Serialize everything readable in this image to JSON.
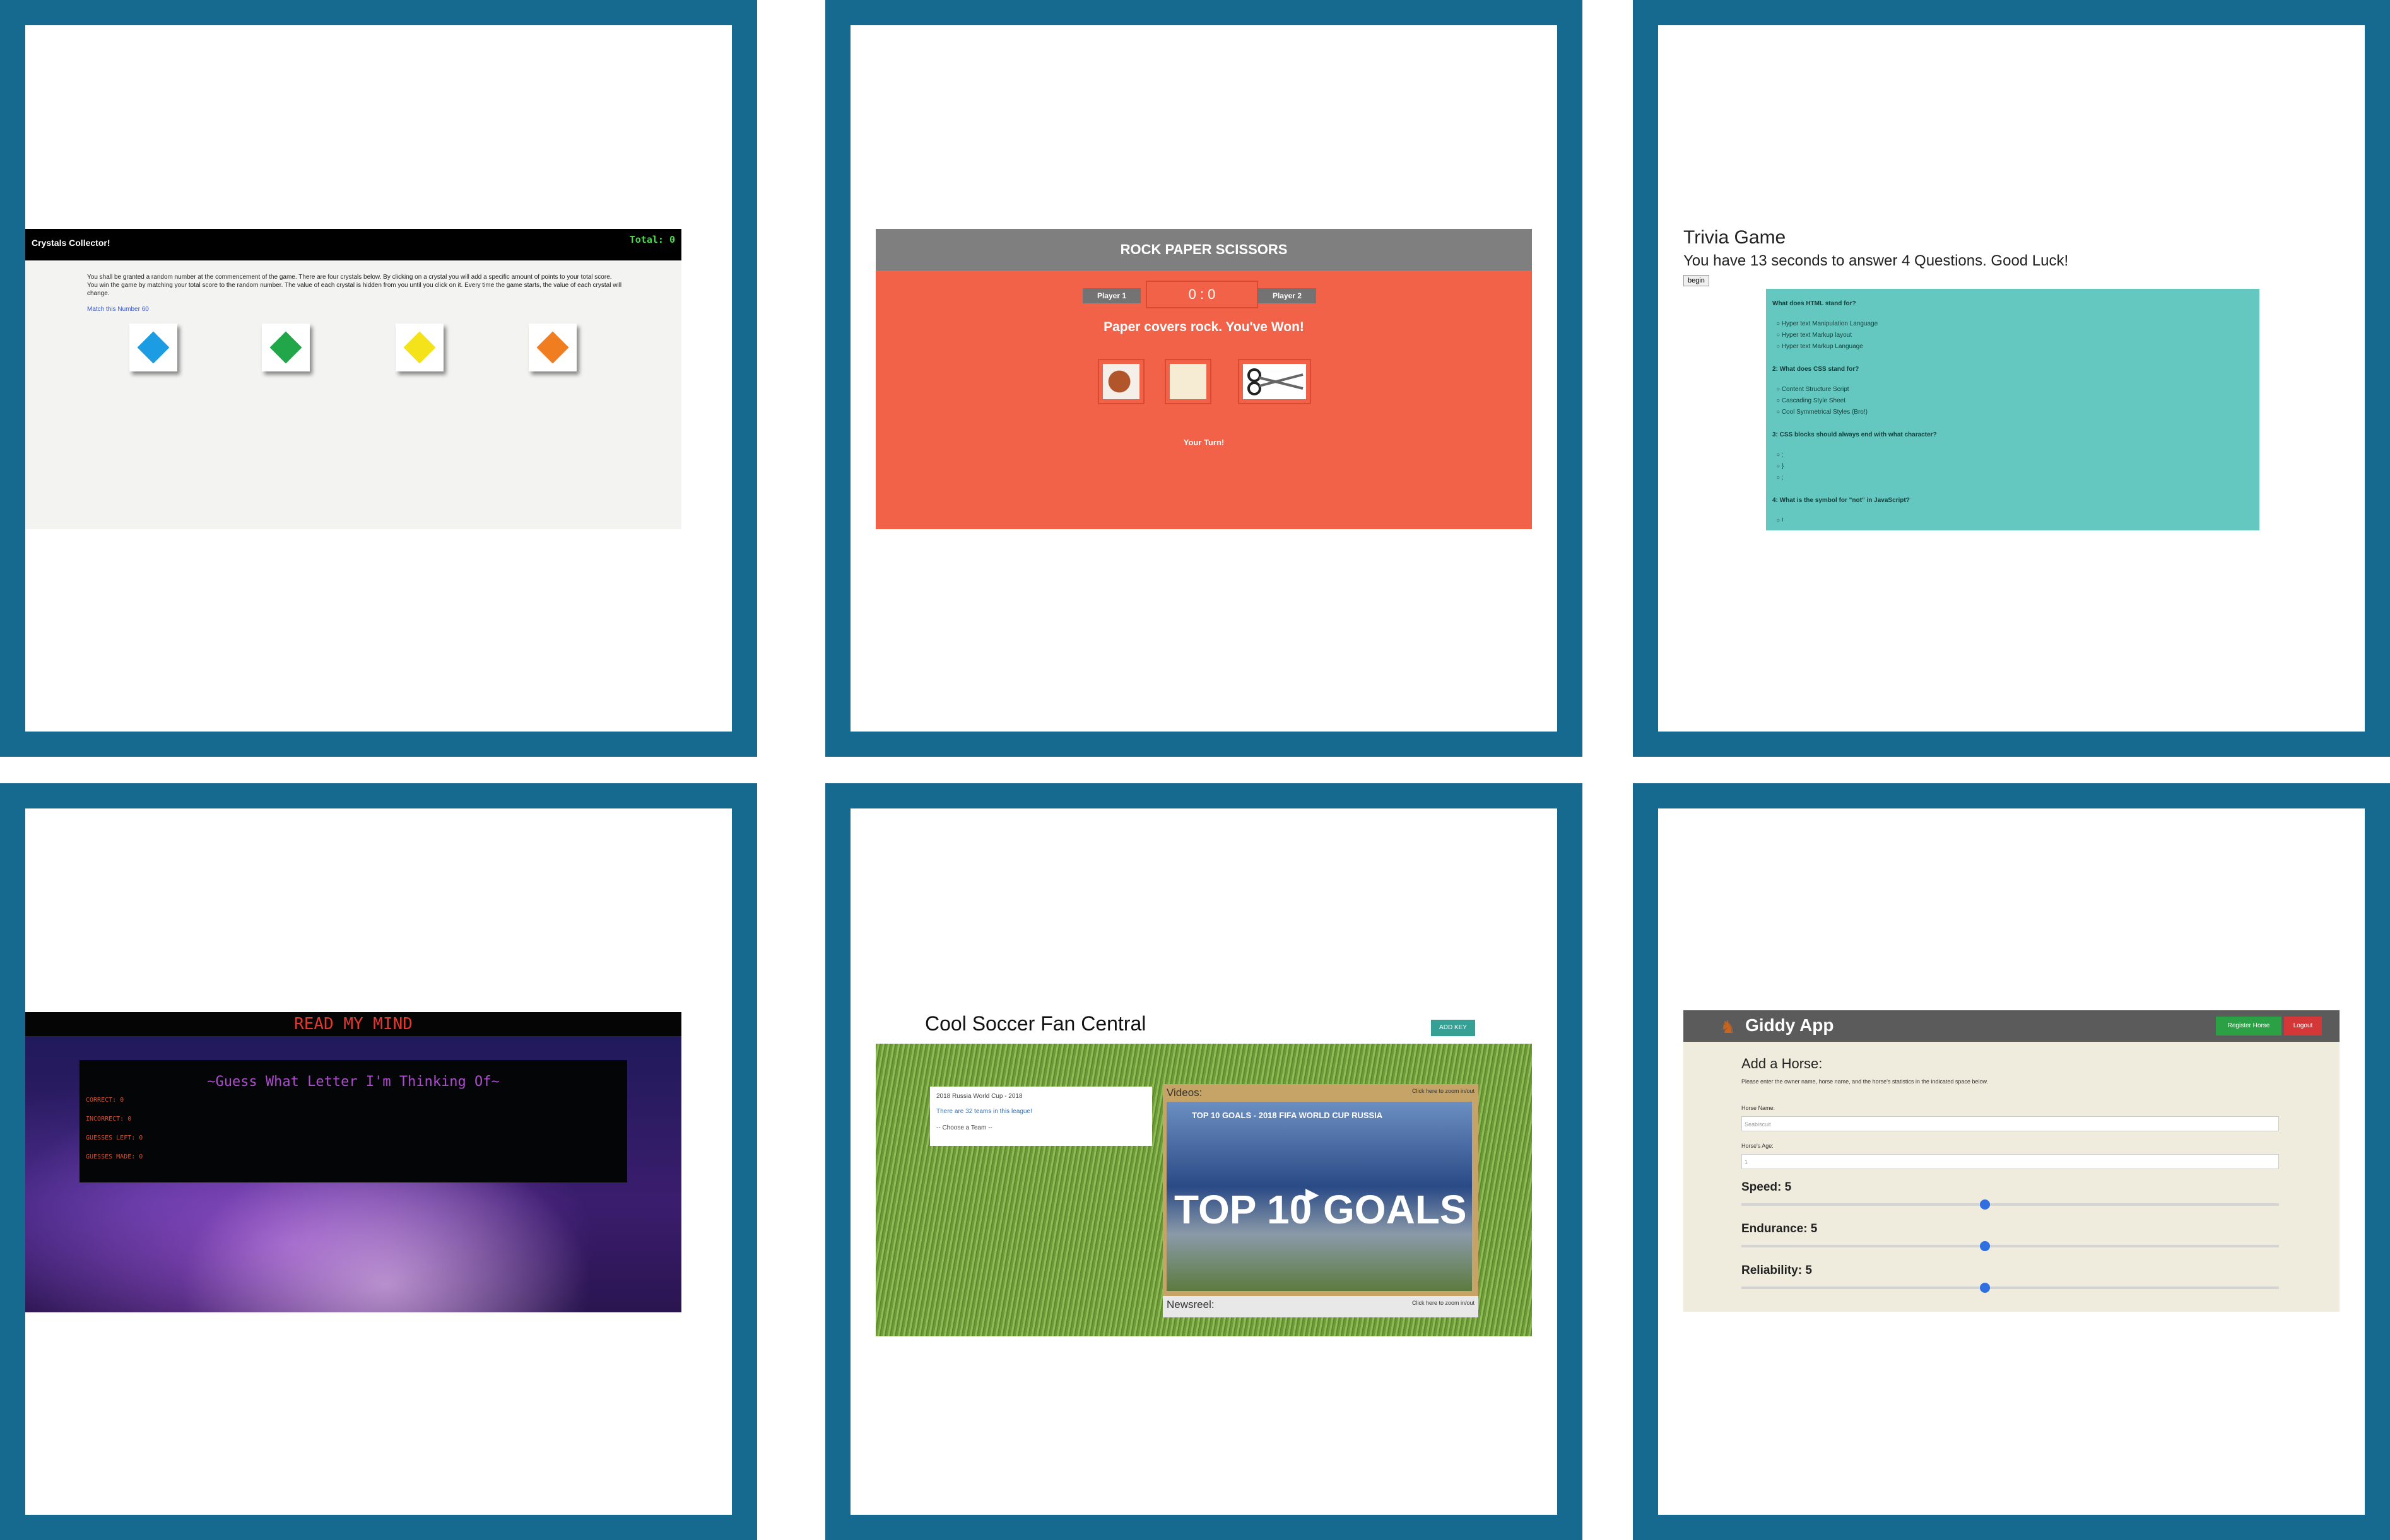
{
  "crystals": {
    "title": "Crystals Collector!",
    "total": "Total: 0",
    "description": "You shall be granted a random number at the commencement of the game. There are four crystals below. By clicking on a crystal you will add a specific amount of points to your total score. You win the game by matching your total score to the random number. The value of each crystal is hidden from you until you click on it. Every time the game starts, the value of each crystal will change.",
    "match": "Match this Number 60",
    "gem_colors": [
      "#1b9ce3",
      "#22a64a",
      "#f4e21b",
      "#f07d20"
    ]
  },
  "rps": {
    "title": "ROCK PAPER SCISSORS",
    "player1": "Player 1",
    "player2": "Player 2",
    "score": "0 : 0",
    "result": "Paper covers rock. You've Won!",
    "turn": "Your Turn!"
  },
  "trivia": {
    "title": "Trivia Game",
    "subtitle": "You have 13 seconds to answer 4 Questions. Good Luck!",
    "begin": "begin",
    "questions": [
      {
        "q": "What does HTML stand for?",
        "options": [
          "Hyper text Manipulation Language",
          "Hyper text Markup layout",
          "Hyper text Markup Language"
        ]
      },
      {
        "q": "2: What does CSS stand for?",
        "options": [
          "Content Structure Script",
          "Cascading Style Sheet",
          "Cool Symmetrical Styles (Bro!)"
        ]
      },
      {
        "q": "3: CSS blocks should always end with what character?",
        "options": [
          ":",
          "}",
          ";"
        ]
      },
      {
        "q": "4: What is the symbol for \"not\" in JavaScript?",
        "options": [
          "!"
        ]
      }
    ]
  },
  "mind": {
    "title": "READ MY MIND",
    "prompt": "~Guess What Letter I'm Thinking Of~",
    "correct": "CORRECT: 0",
    "incorrect": "INCORRECT: 0",
    "guesses_left": "GUESSES LEFT: 0",
    "guesses_made": "GUESSES MADE: 0"
  },
  "soccer": {
    "title": "Cool Soccer Fan Central",
    "add_key": "ADD KEY",
    "league": "2018 Russia World Cup - 2018",
    "team_count": "There are 32 teams in this league!",
    "team_placeholder": "-- Choose a Team --",
    "videos_label": "Videos:",
    "zoom_hint": "Click here to zoom in/out",
    "video_title": "TOP 10 GOALS - 2018 FIFA WORLD CUP RUSSIA",
    "video_caption": "TOP 10 GOALS",
    "newsreel_label": "Newsreel:"
  },
  "giddy": {
    "app_name": "Giddy App",
    "register": "Register Horse",
    "logout": "Logout",
    "heading": "Add a Horse:",
    "instructions": "Please enter the owner name, horse name, and the horse's statistics in the indicated space below.",
    "horse_name_label": "Horse Name:",
    "horse_name_value": "Seabiscuit",
    "horse_age_label": "Horse's Age:",
    "horse_age_value": "1",
    "speed": "Speed: 5",
    "endurance": "Endurance: 5",
    "reliability": "Reliability: 5",
    "slider_value_fraction": 0.5
  }
}
